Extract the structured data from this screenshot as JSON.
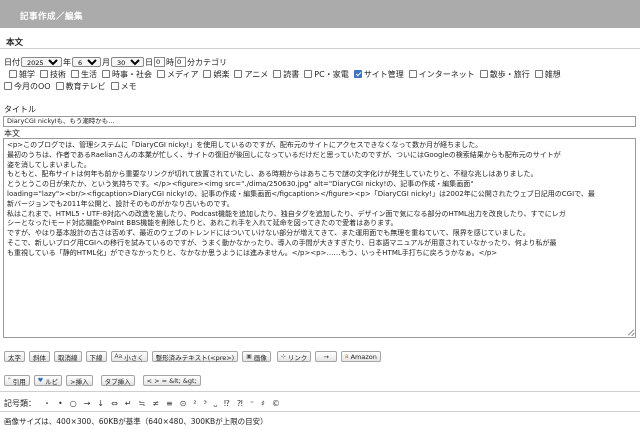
{
  "header": {
    "title": "記事作成／編集"
  },
  "section": {
    "title": "本文"
  },
  "date": {
    "label": "日付",
    "year": "2025",
    "year_unit": "年",
    "month": "6",
    "month_unit": "月",
    "day": "30",
    "day_unit": "日",
    "hour": "0",
    "hour_unit": "時",
    "minute": "0",
    "minute_unit": "分",
    "category_label": "カテゴリ"
  },
  "categories": [
    {
      "label": "雑学",
      "checked": false
    },
    {
      "label": "技術",
      "checked": false
    },
    {
      "label": "生活",
      "checked": false
    },
    {
      "label": "時事・社会",
      "checked": false
    },
    {
      "label": "メディア",
      "checked": false
    },
    {
      "label": "娯楽",
      "checked": false
    },
    {
      "label": "アニメ",
      "checked": false
    },
    {
      "label": "読書",
      "checked": false
    },
    {
      "label": "PC・家電",
      "checked": false
    },
    {
      "label": "サイト管理",
      "checked": true
    },
    {
      "label": "インターネット",
      "checked": false
    },
    {
      "label": "散歩・旅行",
      "checked": false
    },
    {
      "label": "雑想",
      "checked": false
    },
    {
      "label": "今月のOO",
      "checked": false
    },
    {
      "label": "教育テレビ",
      "checked": false
    },
    {
      "label": "メモ",
      "checked": false
    }
  ],
  "title_field": {
    "label": "タイトル",
    "value": "DiaryCGI nickyIも、もう潮時かも…"
  },
  "body_field": {
    "label": "本文",
    "lines": [
      "<p>このブログでは、管理システムに「DiaryCGI nicky!」を使用しているのですが、配布元のサイトにアクセスできなくなって数か月が経ちました。",
      "最初のうちは、作者であるRaelianさんの本業が忙しく、サイトの復旧が後回しになっているだけだと思っていたのですが、ついにはGoogleの検索結果からも配布元のサイトが",
      "姿を消してしまいました。",
      "もともと、配布サイトは何年も前から重要なリンクが切れて放置されていたし、ある時期からはあちこちで謎の文字化けが発生していたりと、不穏な兆しはありました。",
      "とうとうこの日が来たか、という気持ちです。</p><figure><img src=\"./dima/250630.jpg\" alt=\"DiaryCGI nicky!の、記事の作成・編集画面\"",
      "loading=\"lazy\"><br/><figcaption>DiaryCGI nicky!の、記事の作成・編集画面</figcaption></figure><p>「DiaryCGI nicky!」は2002年に公開されたウェブ日記用のCGIで、最",
      "新バージョンでも2011年公開と、設計そのものがかなり古いものです。",
      "私はこれまで、HTML5・UTF-8対応への改造を施したり、Podcast機能を追加したり、独自タグを追加したり、デザイン面で気になる部分のHTML出力を改良したり、すでにレガ",
      "シーとなったiモード対応機能やPaint BBS機能を削除したりと、あれこれ手を入れて延命を図ってきたので愛着はあります。",
      "ですが、やはり基本設計の古さは否めず、最近のウェブのトレンドにはついていけない部分が増えてきて、また運用面でも無理を重ねていて、限界を感じていました。",
      "そこで、新しいブログ用CGIへの移行を試みているのですが、うまく動かなかったり、導入の手間が大きすぎたり、日本語マニュアルが用意されていなかったり、何より私が最",
      "も重視している「静的HTML化」ができなかったりと、なかなか思うようには進みません。</p><p>……もう、いっそHTML手打ちに戻ろうかなぁ。</p>"
    ]
  },
  "toolbar1": [
    {
      "label": "太字",
      "icon": ""
    },
    {
      "label": "斜体",
      "icon": ""
    },
    {
      "label": "取消線",
      "icon": ""
    },
    {
      "label": "下線",
      "icon": ""
    },
    {
      "label": "小さく",
      "icon": "Aa"
    },
    {
      "label": "整形済みテキスト(<pre>)",
      "icon": ""
    },
    {
      "label": "画像",
      "icon": "▣"
    },
    {
      "label": "リンク",
      "icon": "⊹"
    },
    {
      "label": "→",
      "icon": ""
    },
    {
      "label": "Amazon",
      "icon": "a"
    }
  ],
  "toolbar2": [
    {
      "label": "引用",
      "icon": "\""
    },
    {
      "label": "ルビ",
      "icon": "♥"
    },
    {
      "label": ">挿入",
      "icon": ""
    },
    {
      "label": "タブ挿入",
      "icon": ""
    },
    {
      "label": "< > = &lt; &gt;",
      "icon": ""
    }
  ],
  "symbols": {
    "label": "記号類：",
    "items": [
      "・",
      "•",
      "○",
      "→",
      "↓",
      "⇔",
      "↵",
      "≒",
      "≠",
      "≡",
      "⊙",
      "²",
      "³",
      "⎵",
      "⁉",
      "⁈",
      "⁼",
      "♯",
      "©"
    ]
  },
  "note": "画像サイズは、400×300、60KBが基準（640×480、300KBが上限の目安）"
}
